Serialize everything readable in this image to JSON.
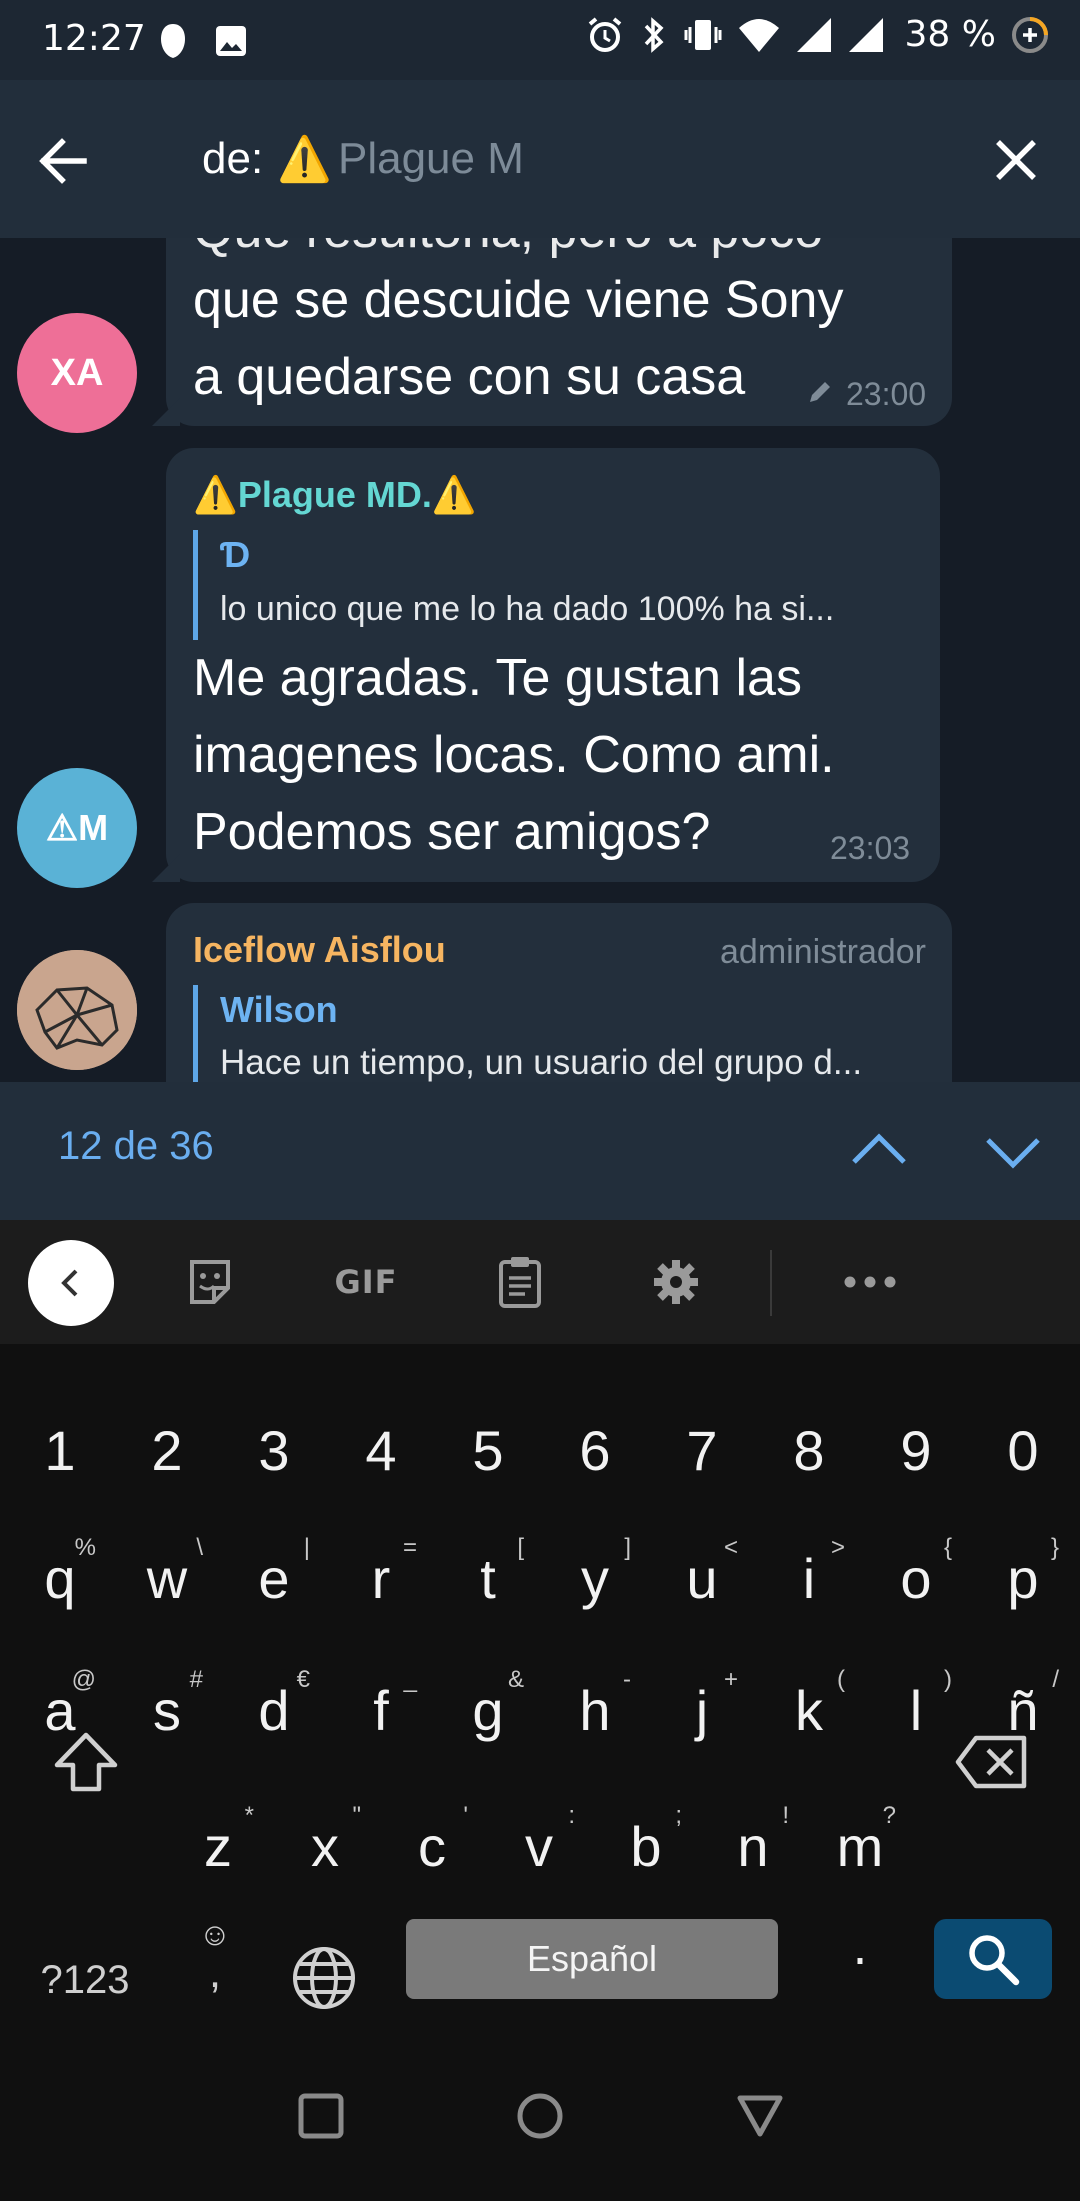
{
  "status_bar": {
    "time": "12:27",
    "battery_text": "38 %"
  },
  "header": {
    "search_prefix": "de:",
    "search_warning_emoji": "⚠️",
    "search_value": "Plague M"
  },
  "messages": [
    {
      "avatar_initials": "XA",
      "avatar_color": "#ee6f97",
      "partial_top_line": "Que resultona, pero a poco",
      "lines": [
        "que se descuide viene Sony",
        "a quedarse con su casa"
      ],
      "edited": true,
      "time": "23:00"
    },
    {
      "avatar_initials": "⚠M",
      "avatar_color": "#5ab2d6",
      "sender": "⚠️Plague MD.⚠️",
      "sender_color": "#64d7d3",
      "reply_name": "Ɗ",
      "reply_text": "lo unico que me lo ha dado 100% ha si...",
      "lines": [
        "Me agradas. Te gustan las",
        "imagenes locas. Como ami.",
        "Podemos ser amigos?"
      ],
      "time": "23:03"
    },
    {
      "sender": "Iceflow Aisflou",
      "sender_color": "#f6b561",
      "role": "administrador",
      "reply_name": "Wilson",
      "reply_text": "Hace un tiempo, un usuario del grupo d..."
    }
  ],
  "search_results": {
    "count_text": "12 de 36"
  },
  "keyboard": {
    "toolbar": {
      "gif_label": "GIF"
    },
    "number_row": [
      "1",
      "2",
      "3",
      "4",
      "5",
      "6",
      "7",
      "8",
      "9",
      "0"
    ],
    "row1": [
      {
        "k": "q",
        "a": "%"
      },
      {
        "k": "w",
        "a": "\\"
      },
      {
        "k": "e",
        "a": "|"
      },
      {
        "k": "r",
        "a": "="
      },
      {
        "k": "t",
        "a": "["
      },
      {
        "k": "y",
        "a": "]"
      },
      {
        "k": "u",
        "a": "<"
      },
      {
        "k": "i",
        "a": ">"
      },
      {
        "k": "o",
        "a": "{"
      },
      {
        "k": "p",
        "a": "}"
      }
    ],
    "row2": [
      {
        "k": "a",
        "a": "@"
      },
      {
        "k": "s",
        "a": "#"
      },
      {
        "k": "d",
        "a": "€"
      },
      {
        "k": "f",
        "a": "_"
      },
      {
        "k": "g",
        "a": "&"
      },
      {
        "k": "h",
        "a": "-"
      },
      {
        "k": "j",
        "a": "+"
      },
      {
        "k": "k",
        "a": "("
      },
      {
        "k": "l",
        "a": ")"
      },
      {
        "k": "ñ",
        "a": "/"
      }
    ],
    "row3": [
      {
        "k": "z",
        "a": "*"
      },
      {
        "k": "x",
        "a": "\""
      },
      {
        "k": "c",
        "a": "'"
      },
      {
        "k": "v",
        "a": ":"
      },
      {
        "k": "b",
        "a": ";"
      },
      {
        "k": "n",
        "a": "!"
      },
      {
        "k": "m",
        "a": "?"
      }
    ],
    "symbols_label": "?123",
    "emoji_glyph": "☺",
    "comma": ",",
    "space_label": "Español",
    "period": "."
  },
  "colors": {
    "accent": "#6aaef0",
    "header_bg": "#222e3b",
    "chat_bg": "#151c26",
    "bubble_bg": "#232f3c",
    "search_key_bg": "#0b4b72"
  }
}
